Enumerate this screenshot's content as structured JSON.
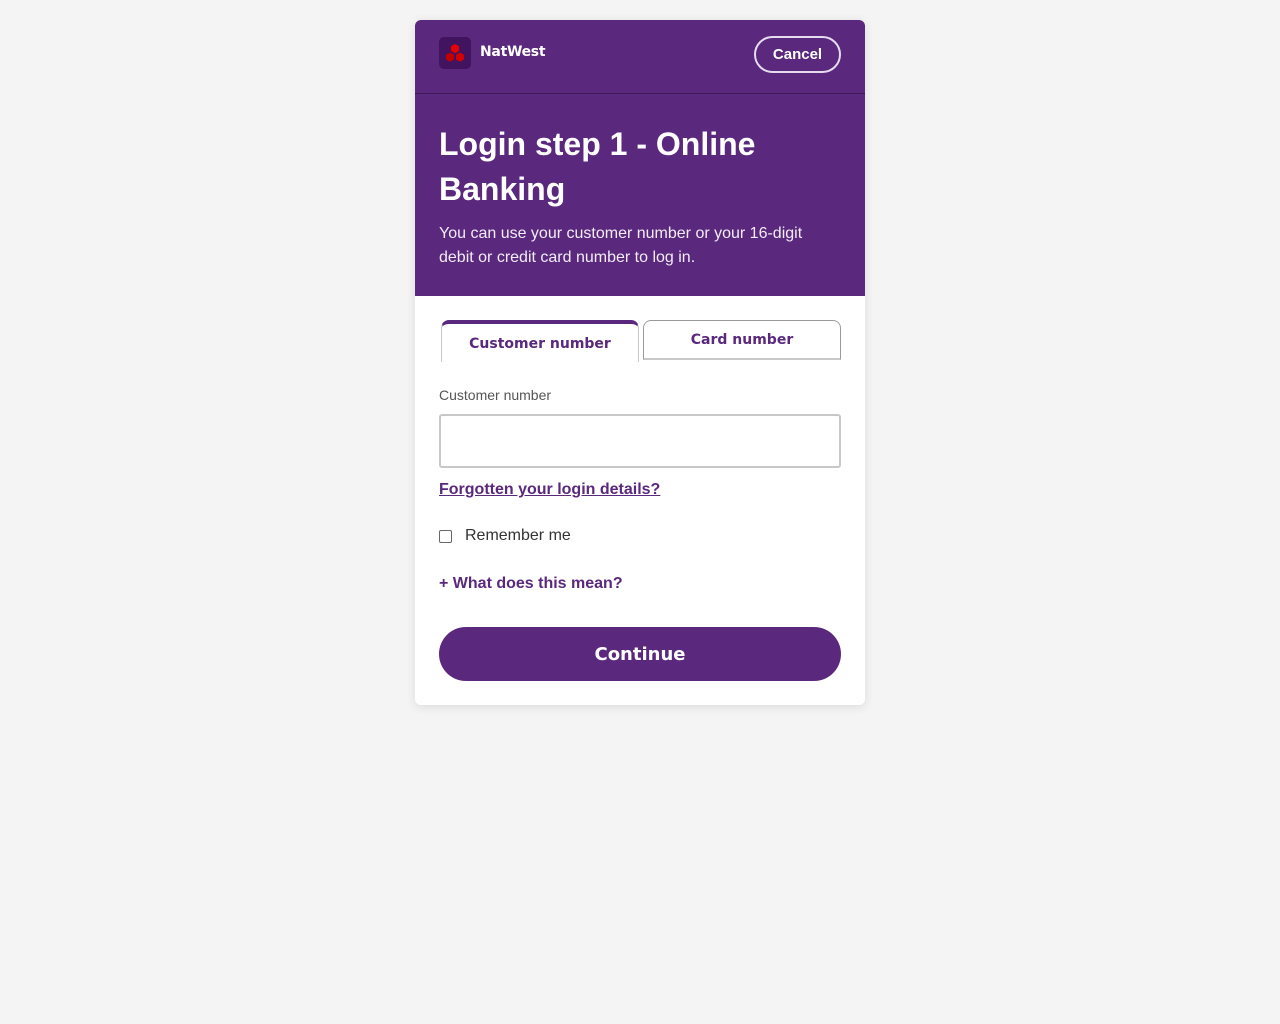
{
  "brand": {
    "name": "NatWest",
    "icon": "natwest-cubes-logo",
    "colors": {
      "primary": "#5a287d",
      "logo_bg": "#42145f",
      "logo_red": "#e60000"
    }
  },
  "header": {
    "cancel_label": "Cancel"
  },
  "hero": {
    "title": "Login step 1 - Online Banking",
    "description": "You can use your customer number or your 16-digit debit or credit card number to log in."
  },
  "tabs": [
    {
      "label": "Customer number",
      "active": true
    },
    {
      "label": "Card number",
      "active": false
    }
  ],
  "form": {
    "field_label": "Customer number",
    "field_value": "",
    "forgot_link": "Forgotten your login details?",
    "remember_label": "Remember me",
    "remember_checked": false,
    "what_link": "+ What does this mean?",
    "continue_label": "Continue"
  }
}
